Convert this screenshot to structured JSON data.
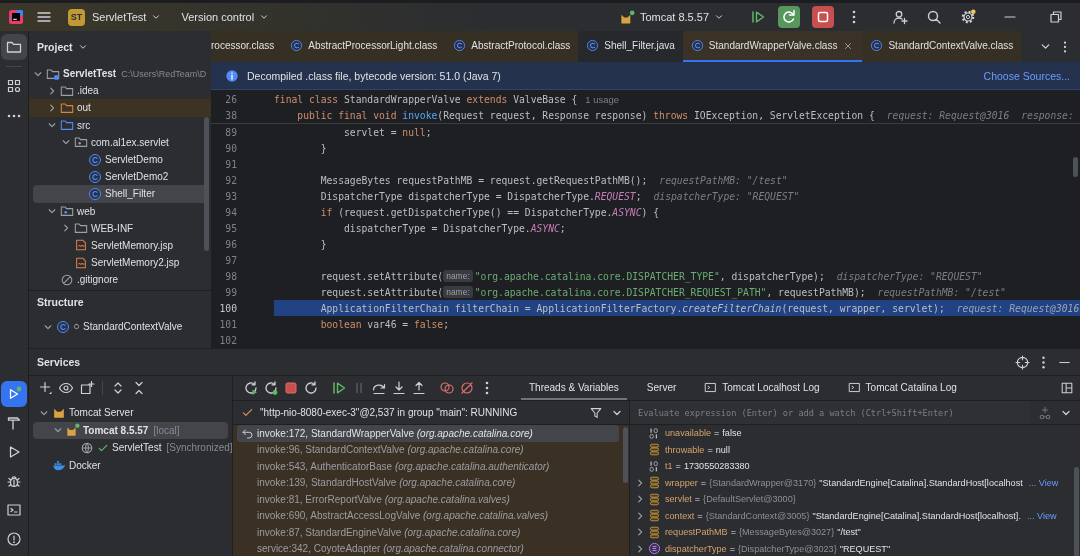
{
  "title_bar": {
    "project_badge": "ST",
    "project_name": "ServletTest",
    "vcs_menu": "Version control",
    "run_config": "Tomcat 8.5.57"
  },
  "tool_strip": {
    "top": [
      {
        "kind": "project",
        "selected": true
      },
      {
        "kind": "structure",
        "selected": false
      },
      {
        "kind": "more",
        "selected": false
      }
    ],
    "bottom": [
      {
        "kind": "services",
        "selected": true
      },
      {
        "kind": "build",
        "selected": false
      },
      {
        "kind": "run",
        "selected": false
      },
      {
        "kind": "debug",
        "selected": false
      },
      {
        "kind": "terminal",
        "selected": false
      },
      {
        "kind": "problems",
        "selected": false
      }
    ]
  },
  "project": {
    "title": "Project",
    "tree": [
      {
        "label": "ServletTest",
        "detail": "C:\\Users\\RedTeam\\D",
        "kind": "module",
        "expanded": true,
        "selected": false,
        "children": [
          {
            "label": ".idea",
            "kind": "folder",
            "expanded": false,
            "selected": false
          },
          {
            "label": "out",
            "kind": "excluded-folder",
            "expanded": false,
            "selected": false
          },
          {
            "label": "src",
            "kind": "source-folder",
            "expanded": true,
            "selected": false,
            "children": [
              {
                "label": "com.al1ex.servlet",
                "kind": "package",
                "expanded": true,
                "selected": false,
                "children": [
                  {
                    "label": "ServletDemo",
                    "kind": "class",
                    "selected": false
                  },
                  {
                    "label": "ServletDemo2",
                    "kind": "class",
                    "selected": false
                  },
                  {
                    "label": "Shell_Filter",
                    "kind": "class",
                    "selected": true
                  }
                ]
              }
            ]
          },
          {
            "label": "web",
            "kind": "web-folder",
            "expanded": true,
            "selected": false,
            "children": [
              {
                "label": "WEB-INF",
                "kind": "folder",
                "expanded": false,
                "selected": false
              },
              {
                "label": "ServletMemory.jsp",
                "kind": "jsp",
                "selected": false
              },
              {
                "label": "ServletMemory2.jsp",
                "kind": "jsp",
                "selected": false
              }
            ]
          },
          {
            "label": ".gitignore",
            "kind": "ignore-file",
            "selected": false
          }
        ]
      }
    ]
  },
  "structure": {
    "title": "Structure",
    "tree": [
      {
        "label": "StandardContextValve",
        "kind": "structure-class",
        "expanded": true,
        "selected": false
      }
    ]
  },
  "editor": {
    "tabs": [
      {
        "label": "rocessor.class",
        "kind": "library",
        "clipped": true,
        "selected": false
      },
      {
        "label": "AbstractProcessorLight.class",
        "kind": "library",
        "clipped": false,
        "selected": false
      },
      {
        "label": "AbstractProtocol.class",
        "kind": "library",
        "clipped": false,
        "selected": false
      },
      {
        "label": "Shell_Filter.java",
        "kind": "project",
        "clipped": false,
        "selected": false
      },
      {
        "label": "StandardWrapperValve.class",
        "kind": "library",
        "clipped": false,
        "selected": true
      },
      {
        "label": "StandardContextValve.class",
        "kind": "library",
        "clipped": false,
        "selected": false
      }
    ],
    "banner": {
      "text": "Decompiled .class file, bytecode version: 51.0 (Java 7)",
      "link": "Choose Sources..."
    },
    "sticky_lines": [
      {
        "number": "26",
        "current": false,
        "tokens": [
          {
            "kind": "keyword",
            "text": "final class"
          },
          {
            "kind": "plain",
            "text": " StandardWrapperValve "
          },
          {
            "kind": "keyword",
            "text": "extends"
          },
          {
            "kind": "plain",
            "text": " ValveBase {"
          },
          {
            "kind": "usage",
            "text": "1 usage"
          }
        ]
      },
      {
        "number": "38",
        "current": false,
        "tokens": [
          {
            "kind": "keyword",
            "text": "    public final void "
          },
          {
            "kind": "method",
            "text": "invoke"
          },
          {
            "kind": "plain",
            "text": "(Request request, Response response) "
          },
          {
            "kind": "keyword",
            "text": "throws"
          },
          {
            "kind": "plain",
            "text": " IOException, ServletException {"
          },
          {
            "kind": "value-hint",
            "text": "request: Request@3016"
          },
          {
            "kind": "value-hint",
            "text": "response:"
          }
        ]
      }
    ],
    "lines": [
      {
        "number": "89",
        "current": false,
        "tokens": [
          {
            "kind": "plain",
            "text": "            servlet = "
          },
          {
            "kind": "keyword",
            "text": "null"
          },
          {
            "kind": "plain",
            "text": ";"
          }
        ]
      },
      {
        "number": "90",
        "current": false,
        "tokens": [
          {
            "kind": "plain",
            "text": "        }"
          }
        ]
      },
      {
        "number": "91",
        "current": false
      },
      {
        "number": "92",
        "current": false,
        "tokens": [
          {
            "kind": "plain",
            "text": "        MessageBytes requestPathMB = request.getRequestPathMB();"
          },
          {
            "kind": "value-hint",
            "text": "requestPathMB: \"/test\""
          }
        ]
      },
      {
        "number": "93",
        "current": false,
        "tokens": [
          {
            "kind": "plain",
            "text": "        DispatcherType dispatcherType = DispatcherType."
          },
          {
            "kind": "constant",
            "text": "REQUEST"
          },
          {
            "kind": "plain",
            "text": ";"
          },
          {
            "kind": "value-hint",
            "text": "dispatcherType: \"REQUEST\""
          }
        ]
      },
      {
        "number": "94",
        "current": false,
        "tokens": [
          {
            "kind": "keyword",
            "text": "        if"
          },
          {
            "kind": "plain",
            "text": " (request.getDispatcherType() == DispatcherType."
          },
          {
            "kind": "constant",
            "text": "ASYNC"
          },
          {
            "kind": "plain",
            "text": ") {"
          }
        ]
      },
      {
        "number": "95",
        "current": false,
        "tokens": [
          {
            "kind": "plain",
            "text": "            dispatcherType = DispatcherType."
          },
          {
            "kind": "constant",
            "text": "ASYNC"
          },
          {
            "kind": "plain",
            "text": ";"
          }
        ]
      },
      {
        "number": "96",
        "current": false,
        "tokens": [
          {
            "kind": "plain",
            "text": "        }"
          }
        ]
      },
      {
        "number": "97",
        "current": false
      },
      {
        "number": "98",
        "current": false,
        "tokens": [
          {
            "kind": "plain",
            "text": "        request.setAttribute("
          },
          {
            "kind": "param-hint",
            "text": "name:"
          },
          {
            "kind": "string",
            "text": "\"org.apache.catalina.core.DISPATCHER_TYPE\""
          },
          {
            "kind": "plain",
            "text": ", dispatcherType);"
          },
          {
            "kind": "value-hint",
            "text": "dispatcherType: \"REQUEST\""
          }
        ]
      },
      {
        "number": "99",
        "current": false,
        "tokens": [
          {
            "kind": "plain",
            "text": "        request.setAttribute("
          },
          {
            "kind": "param-hint",
            "text": "name:"
          },
          {
            "kind": "string",
            "text": "\"org.apache.catalina.core.DISPATCHER_REQUEST_PATH\""
          },
          {
            "kind": "plain",
            "text": ", requestPathMB);"
          },
          {
            "kind": "value-hint",
            "text": "requestPathMB: \"/test\""
          }
        ]
      },
      {
        "number": "100",
        "current": true,
        "tokens": [
          {
            "kind": "plain",
            "text": "        ApplicationFilterChain filterChain = ApplicationFilterFactory."
          },
          {
            "kind": "call",
            "text": "createFilterChain"
          },
          {
            "kind": "plain",
            "text": "(request, wrapper, servlet);"
          },
          {
            "kind": "value-hint",
            "text": "request: Request@3016"
          }
        ]
      },
      {
        "number": "101",
        "current": false,
        "tokens": [
          {
            "kind": "keyword",
            "text": "        boolean"
          },
          {
            "kind": "plain",
            "text": " var46 = "
          },
          {
            "kind": "keyword",
            "text": "false"
          },
          {
            "kind": "plain",
            "text": ";"
          }
        ]
      },
      {
        "number": "102",
        "current": false
      }
    ]
  },
  "services": {
    "title": "Services",
    "tree": [
      {
        "label": "Tomcat Server",
        "kind": "tomcat-group",
        "expanded": true,
        "selected": false,
        "children": [
          {
            "label": "Tomcat 8.5.57",
            "detail": "[local]",
            "kind": "tomcat",
            "expanded": true,
            "selected": true,
            "children": [
              {
                "label": "ServletTest",
                "detail": "[Synchronized]",
                "kind": "artifact",
                "selected": false
              }
            ]
          }
        ]
      },
      {
        "label": "Docker",
        "kind": "docker",
        "selected": false
      }
    ],
    "debugger": {
      "toolbar": [
        {
          "kind": "rerun",
          "disabled": false
        },
        {
          "kind": "rerun-debug",
          "disabled": false
        },
        {
          "kind": "stop",
          "disabled": false
        },
        {
          "kind": "restart",
          "disabled": false
        },
        {
          "kind": "resume",
          "disabled": false
        },
        {
          "kind": "pause",
          "disabled": true
        },
        {
          "kind": "step-over",
          "disabled": false
        },
        {
          "kind": "step-into",
          "disabled": false
        },
        {
          "kind": "step-out",
          "disabled": false
        },
        {
          "kind": "breakpoints",
          "disabled": false
        },
        {
          "kind": "mute-breakpoints",
          "disabled": false
        },
        {
          "kind": "more",
          "disabled": false
        }
      ],
      "tabs": [
        {
          "label": "Threads & Variables",
          "kind": "view",
          "selected": true
        },
        {
          "label": "Server",
          "kind": "view",
          "selected": false
        },
        {
          "label": "Tomcat Localhost Log",
          "kind": "log",
          "selected": false
        },
        {
          "label": "Tomcat Catalina Log",
          "kind": "log",
          "selected": false
        }
      ],
      "thread": "\"http-nio-8080-exec-3\"@2,537 in group \"main\": RUNNING",
      "frames": [
        {
          "text": "invoke:172, StandardWrapperValve *(org.apache.catalina.core)*",
          "selected": true
        },
        {
          "text": "invoke:96, StandardContextValve *(org.apache.catalina.core)*",
          "selected": false
        },
        {
          "text": "invoke:543, AuthenticatorBase *(org.apache.catalina.authenticator)*",
          "selected": false
        },
        {
          "text": "invoke:139, StandardHostValve *(org.apache.catalina.core)*",
          "selected": false
        },
        {
          "text": "invoke:81, ErrorReportValve *(org.apache.catalina.valves)*",
          "selected": false
        },
        {
          "text": "invoke:690, AbstractAccessLogValve *(org.apache.catalina.valves)*",
          "selected": false
        },
        {
          "text": "invoke:87, StandardEngineValve *(org.apache.catalina.core)*",
          "selected": false
        },
        {
          "text": "service:342, CoyoteAdapter *(org.apache.catalina.connector)*",
          "selected": false
        }
      ],
      "watch": {
        "placeholder": "Evaluate expression (Enter) or add a watch (Ctrl+Shift+Enter)"
      },
      "variables": [
        {
          "name": "unavailable",
          "operator": "=",
          "value": "false",
          "kind": "primitive"
        },
        {
          "name": "throwable",
          "operator": "=",
          "value": "null",
          "kind": "field"
        },
        {
          "name": "t1",
          "operator": "=",
          "value": "1730550283380",
          "kind": "primitive"
        },
        {
          "name": "wrapper",
          "operator": "=",
          "ref": "{StandardWrapper@3170}",
          "value": "\"StandardEngine[Catalina].StandardHost[localhost",
          "link": "... View",
          "kind": "field",
          "expanded": false
        },
        {
          "name": "servlet",
          "operator": "=",
          "ref": "{DefaultServlet@3000}",
          "kind": "field",
          "expanded": false
        },
        {
          "name": "context",
          "operator": "=",
          "ref": "{StandardContext@3005}",
          "value": "\"StandardEngine[Catalina].StandardHost[localhost].",
          "link": "... View",
          "kind": "field",
          "expanded": false
        },
        {
          "name": "requestPathMB",
          "operator": "=",
          "ref": "{MessageBytes@3027}",
          "value": "\"/test\"",
          "kind": "field",
          "expanded": false
        },
        {
          "name": "dispatcherType",
          "operator": "=",
          "ref": "{DispatcherType@3023}",
          "value": "\"REQUEST\"",
          "kind": "enum",
          "expanded": false
        }
      ]
    }
  }
}
